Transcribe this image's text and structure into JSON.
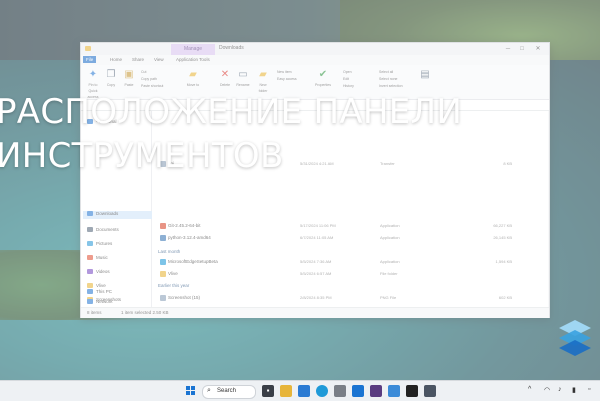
{
  "headline": {
    "line1": "РАСПОЛОЖЕНИЕ ПАНЕЛИ",
    "line2": "ИНСТРУМЕНТОВ"
  },
  "explorer": {
    "title": "Downloads",
    "context_tab": "Manage",
    "ribbon_tabs": [
      "File",
      "Home",
      "Share",
      "View",
      "Application Tools"
    ],
    "active_tab_index": 1,
    "ribbon_buttons": [
      "Pin to Quick access",
      "Copy",
      "Paste",
      "Move to",
      "Delete",
      "Rename",
      "New folder",
      "Properties",
      "Open",
      "Select"
    ],
    "ribbon_small": {
      "cut": "Cut",
      "copy_path": "Copy path",
      "paste_shortcut": "Paste shortcut",
      "new_item": "New item",
      "easy_access": "Easy access",
      "open": "Open",
      "edit": "Edit",
      "history": "History",
      "select_all": "Select all",
      "select_none": "Select none",
      "invert_selection": "Invert selection"
    },
    "nav": [
      {
        "label": "- Personal",
        "color": "#2b7bd3"
      },
      {
        "label": "Downloads",
        "color": "#2b7bd3"
      },
      {
        "label": "Documents",
        "color": "#5a6b7f"
      },
      {
        "label": "Pictures",
        "color": "#2f9bd8"
      },
      {
        "label": "Music",
        "color": "#e2553c"
      },
      {
        "label": "Videos",
        "color": "#7b4fc4"
      },
      {
        "label": "Vlive",
        "color": "#e7b53a"
      },
      {
        "label": "Screenshots",
        "color": "#e7b53a"
      },
      {
        "label": "This PC",
        "color": "#2b7bd3"
      },
      {
        "label": "Network",
        "color": "#2b7bd3"
      }
    ],
    "files": [
      {
        "name": "ngi",
        "date": "5/31/2024 4:21 AM",
        "type": "Transfer",
        "size": "8 KB",
        "color": "#8aa0b8"
      },
      {
        "name": "Git-2.45.2-64-bit",
        "date": "5/17/2024 11:06 PM",
        "type": "Application",
        "size": "66,227 KB",
        "color": "#d8482e"
      },
      {
        "name": "python-3.12.4-amd64",
        "date": "6/7/2024 11:05 AM",
        "type": "Application",
        "size": "26,145 KB",
        "color": "#3c78b5"
      },
      {
        "name": "MicrosoftEdgeSetupBeta",
        "date": "5/5/2024 7:36 AM",
        "type": "Application",
        "size": "1,594 KB",
        "color": "#1f9ad8"
      },
      {
        "name": "Vlive",
        "date": "5/5/2024 6:57 AM",
        "type": "File folder",
        "size": "",
        "color": "#e7b53a"
      },
      {
        "name": "Screenshot (15)",
        "date": "2/8/2024 8:35 PM",
        "type": "PNG File",
        "size": "602 KB",
        "color": "#8aa0b8"
      }
    ],
    "groups": [
      "Last month",
      "Earlier this year"
    ],
    "status": {
      "count": "8 items",
      "selected": "1 item selected 2.50 KB"
    }
  },
  "taskbar": {
    "search_label": "Search"
  },
  "colors": {
    "accent": "#1f6fc9",
    "headline": "#ffffff"
  }
}
